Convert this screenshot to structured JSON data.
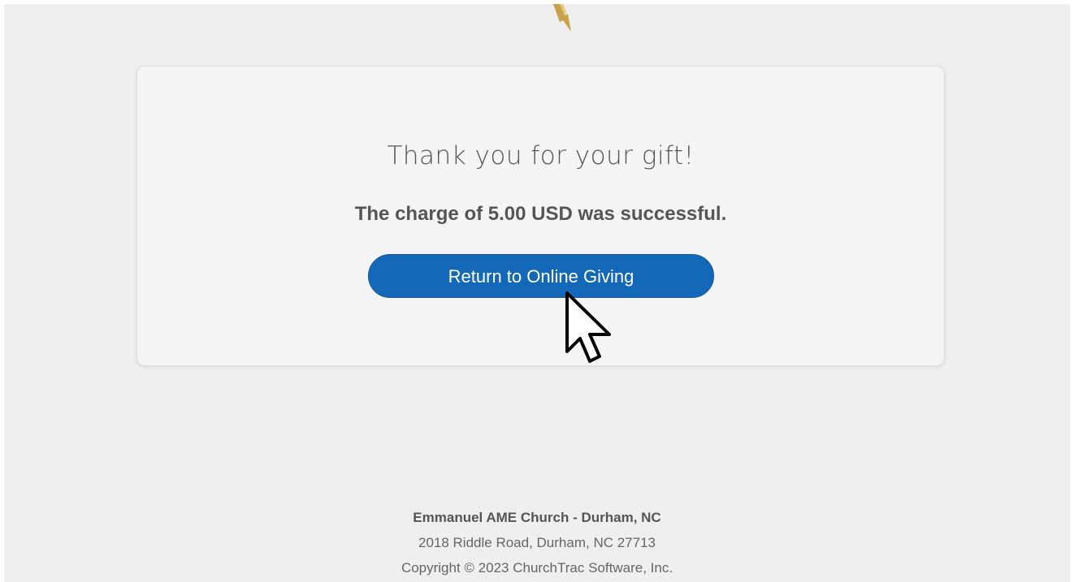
{
  "card": {
    "thanks_heading": "Thank you for your gift!",
    "charge_message": "The charge of 5.00 USD was successful.",
    "return_button_label": "Return to Online Giving"
  },
  "footer": {
    "organization": "Emmanuel AME Church - Durham, NC",
    "address": "2018 Riddle Road, Durham, NC 27713",
    "copyright": "Copyright © 2023 ChurchTrac Software, Inc."
  },
  "colors": {
    "page_background": "#efefef",
    "card_background": "#f5f5f5",
    "button_background": "#1468b8",
    "button_text": "#ffffff",
    "text_gray": "#555555",
    "logo_gold": "#c9a24a"
  },
  "icons": {
    "logo": "church-logo-fragment-icon",
    "cursor": "mouse-pointer-icon"
  }
}
